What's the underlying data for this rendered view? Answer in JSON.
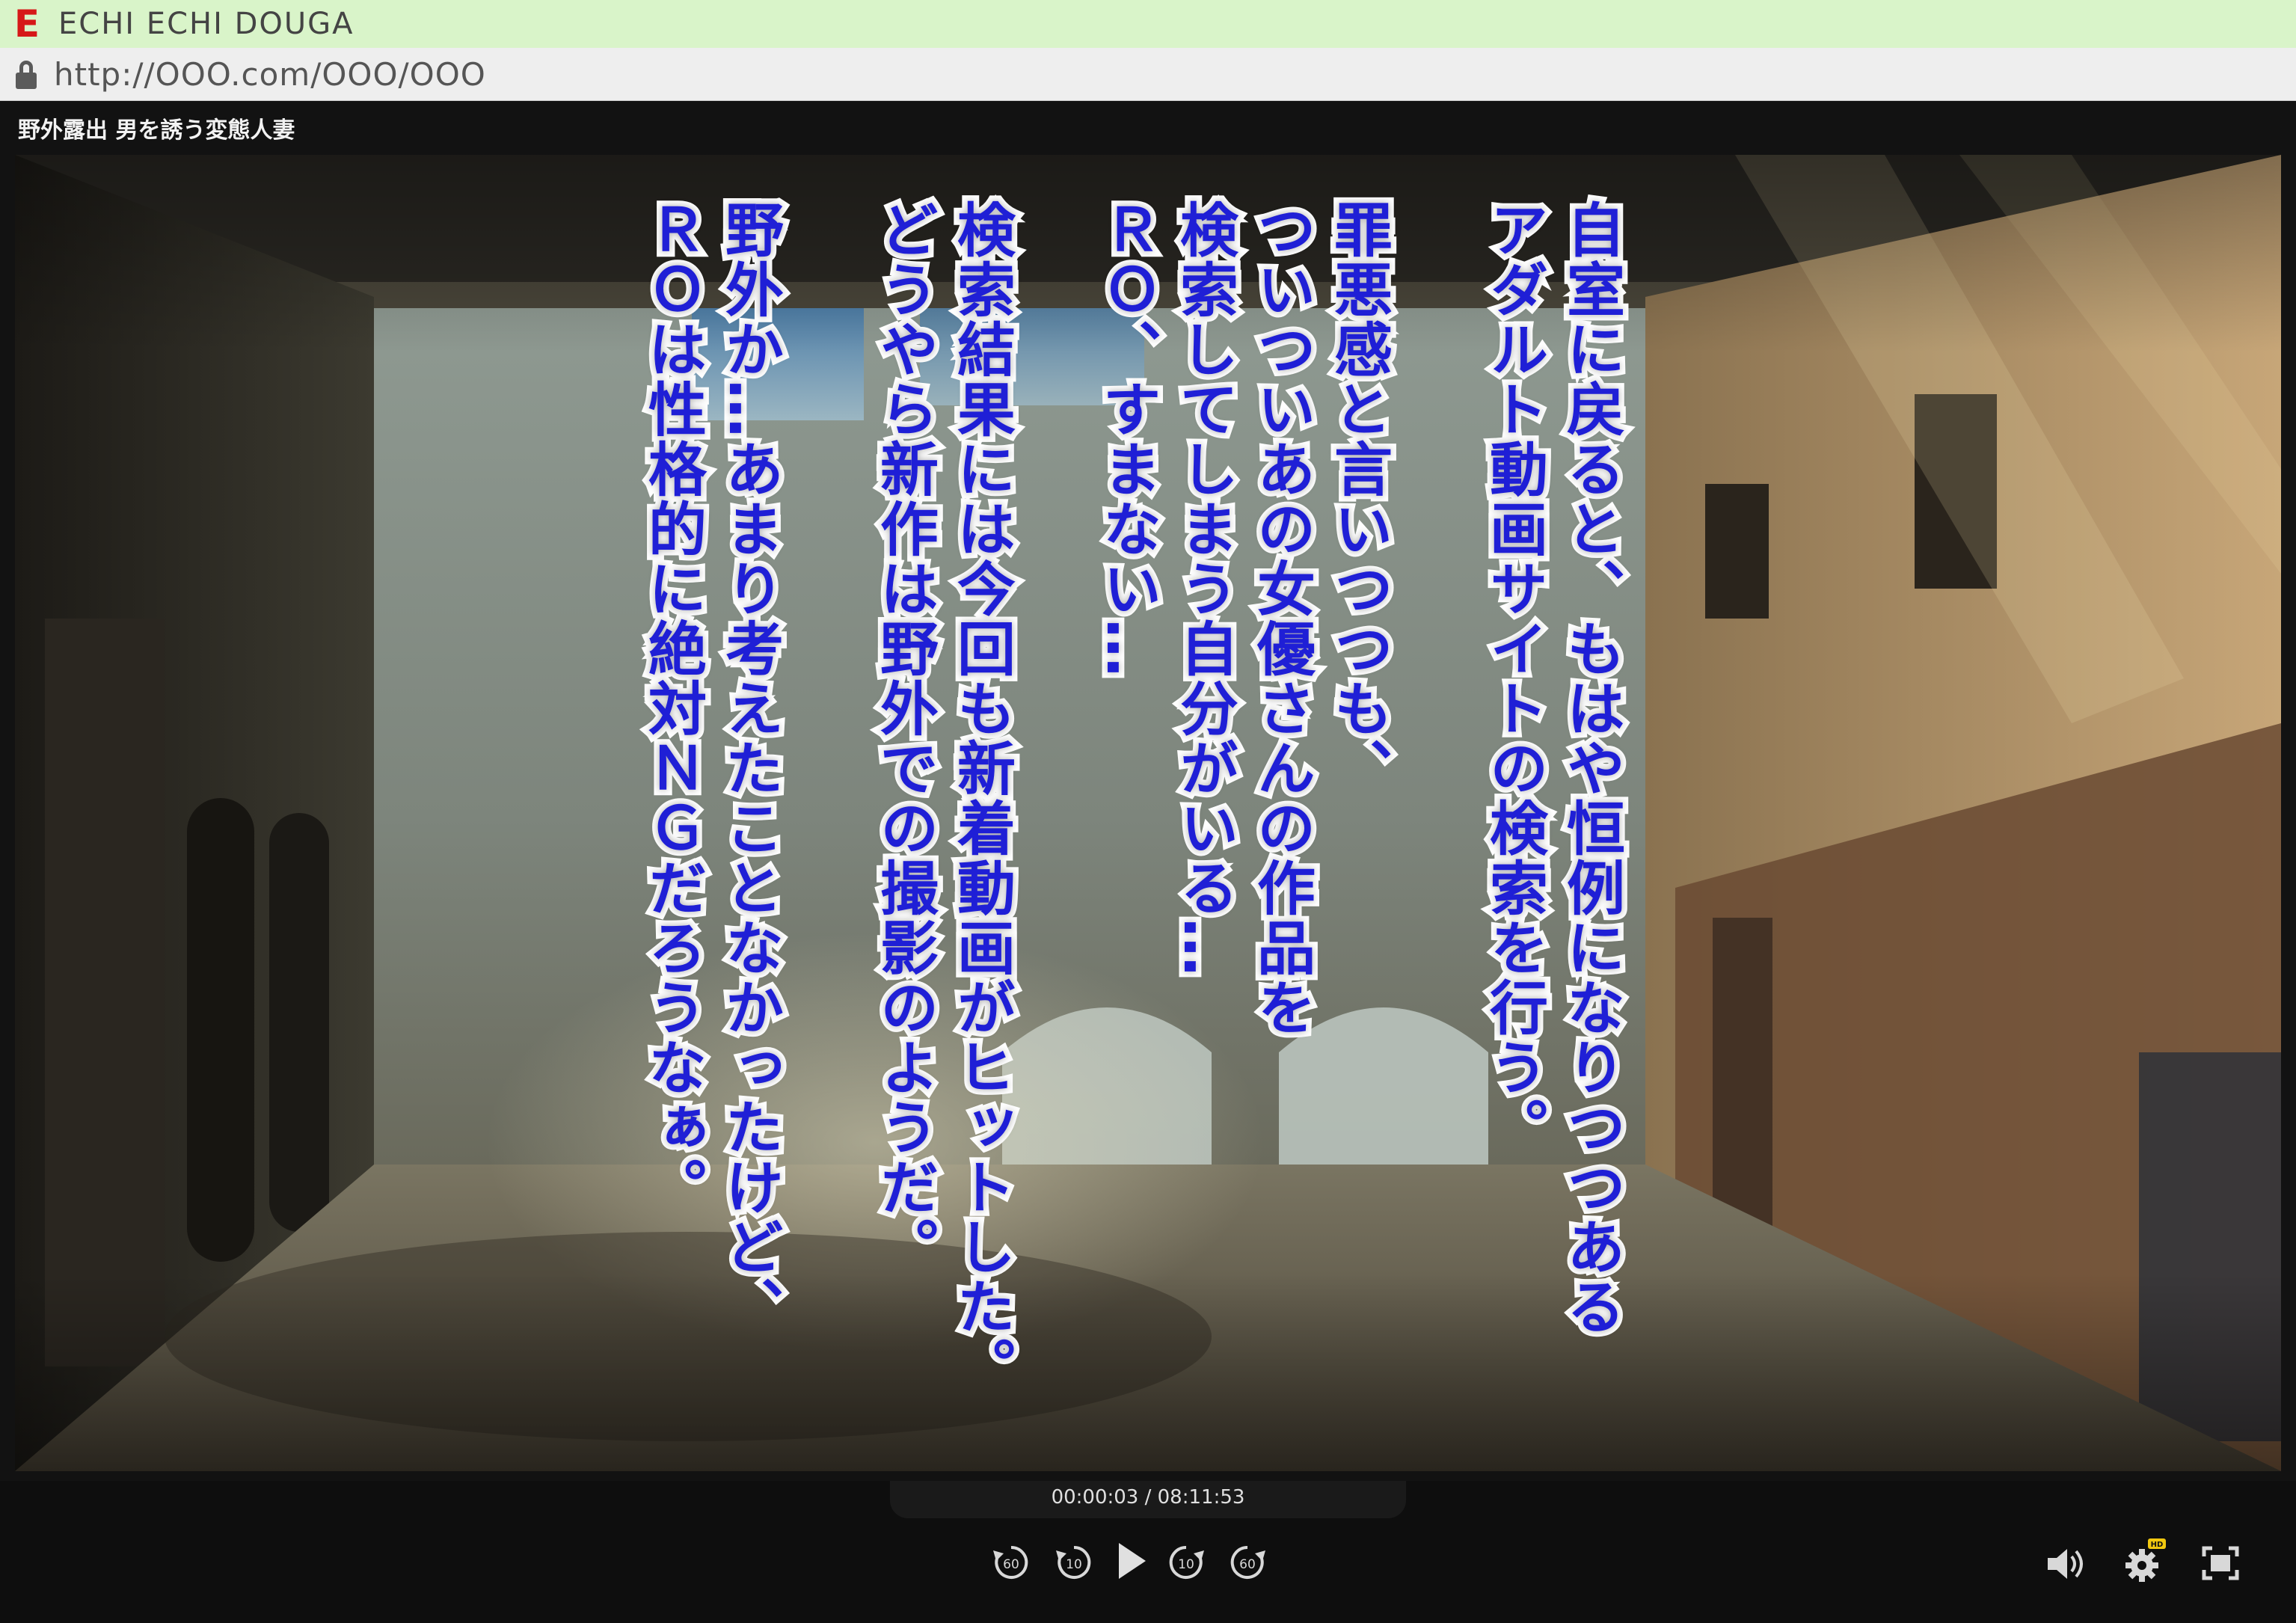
{
  "site": {
    "logo_letter": "E",
    "name": "ECHI ECHI DOUGA",
    "url": "http://OOO.com/OOO/OOO",
    "brand_color": "#d61818",
    "header_bg": "#d9f4c9"
  },
  "player": {
    "title": "野外露出 男を誘う変態人妻",
    "time_current": "00:00:03",
    "time_separator": "/",
    "time_total": "08:11:53",
    "time_display": "00:00:03 / 08:11:53",
    "controls": {
      "rewind_60": "60",
      "rewind_10": "10",
      "forward_10": "10",
      "forward_60": "60",
      "hd_badge": "HD"
    },
    "icons": [
      "rewind-60-icon",
      "rewind-10-icon",
      "play-icon",
      "forward-10-icon",
      "forward-60-icon",
      "volume-icon",
      "settings-gear-icon",
      "fullscreen-icon",
      "lock-icon"
    ]
  },
  "captions": {
    "col1": "自室に戻ると、もはや恒例になりつつある",
    "col2": "アダルト動画サイトの検索を行う。",
    "col3": "罪悪感と言いつつも、",
    "col4": "ついついあの女優さんの作品を",
    "col5": "検索してしまう自分がいる…",
    "col6": "ＲＯ、すまない…",
    "col7": "検索結果には今回も新着動画がヒットした。",
    "col8": "どうやら新作は野外での撮影のようだ。",
    "col9": "野外か…あまり考えたことなかったけど、",
    "col10": "ＲＯは性格的に絶対ＮＧだろうなぁ。",
    "text_color": "#1f1fd6",
    "outline_color": "#ffffff"
  }
}
